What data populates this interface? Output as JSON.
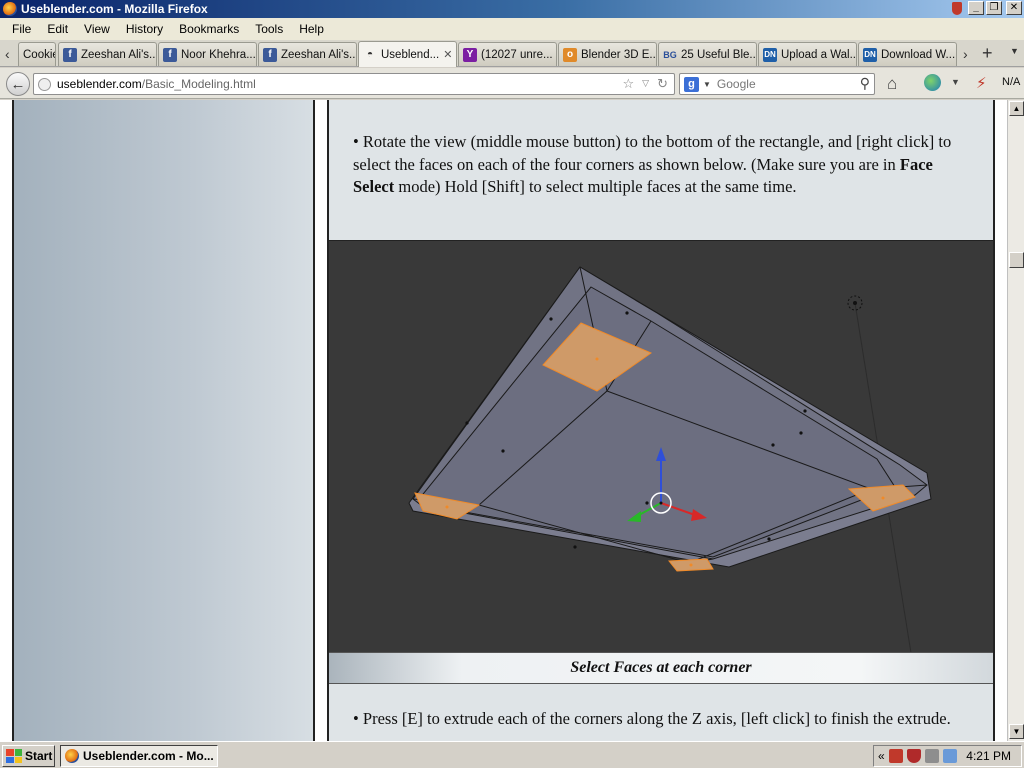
{
  "window": {
    "title": "Useblender.com - Mozilla Firefox",
    "minimize": "_",
    "maximize": "❐",
    "close": "✕"
  },
  "menu": {
    "items": [
      "File",
      "Edit",
      "View",
      "History",
      "Bookmarks",
      "Tools",
      "Help"
    ]
  },
  "tabs": [
    {
      "label": "Cookie",
      "icon": "none-icon",
      "active": false
    },
    {
      "label": "Zeeshan Ali's...",
      "icon": "facebook-icon",
      "active": false
    },
    {
      "label": "Noor Khehra...",
      "icon": "facebook-icon",
      "active": false
    },
    {
      "label": "Zeeshan Ali's...",
      "icon": "facebook-icon",
      "active": false
    },
    {
      "label": "Useblend...",
      "icon": "blender-icon",
      "active": true
    },
    {
      "label": "(12027 unre...",
      "icon": "yahoo-icon",
      "active": false
    },
    {
      "label": "Blender 3D E...",
      "icon": "bookmark-icon",
      "active": false
    },
    {
      "label": "25 Useful Ble...",
      "icon": "bg-icon",
      "active": false
    },
    {
      "label": "Upload a Wal...",
      "icon": "dn-icon",
      "active": false
    },
    {
      "label": "Download W...",
      "icon": "dn-icon",
      "active": false
    }
  ],
  "nav": {
    "url_domain": "useblender.com",
    "url_path": "/Basic_Modeling.html",
    "search_placeholder": "Google",
    "search_engine_letter": "g",
    "extension_label": "N/A"
  },
  "article": {
    "para1_before_bold": "•  Rotate the view (middle mouse button) to the bottom of the rectangle, and [right click] to select the faces on each of the four corners as shown below. (Make sure you are in ",
    "para1_bold": "Face Select",
    "para1_after_bold": " mode) Hold [Shift] to select multiple faces at the same time.",
    "image_caption": "Select Faces at each corner",
    "para2": "•  Press [E] to extrude each of the corners along the Z axis, [left click] to finish the extrude."
  },
  "colors": {
    "viewport_bg": "#393939",
    "mesh_face": "#6c6e80",
    "selected_face": "#cf9a68",
    "selected_edge": "#f08a28",
    "gizmo_z": "#2f4fd8",
    "gizmo_x": "#d82828",
    "gizmo_y": "#28b828"
  },
  "taskbar": {
    "start_label": "Start",
    "task_label": "Useblender.com - Mo...",
    "clock": "4:21 PM",
    "tray_expand": "«"
  }
}
